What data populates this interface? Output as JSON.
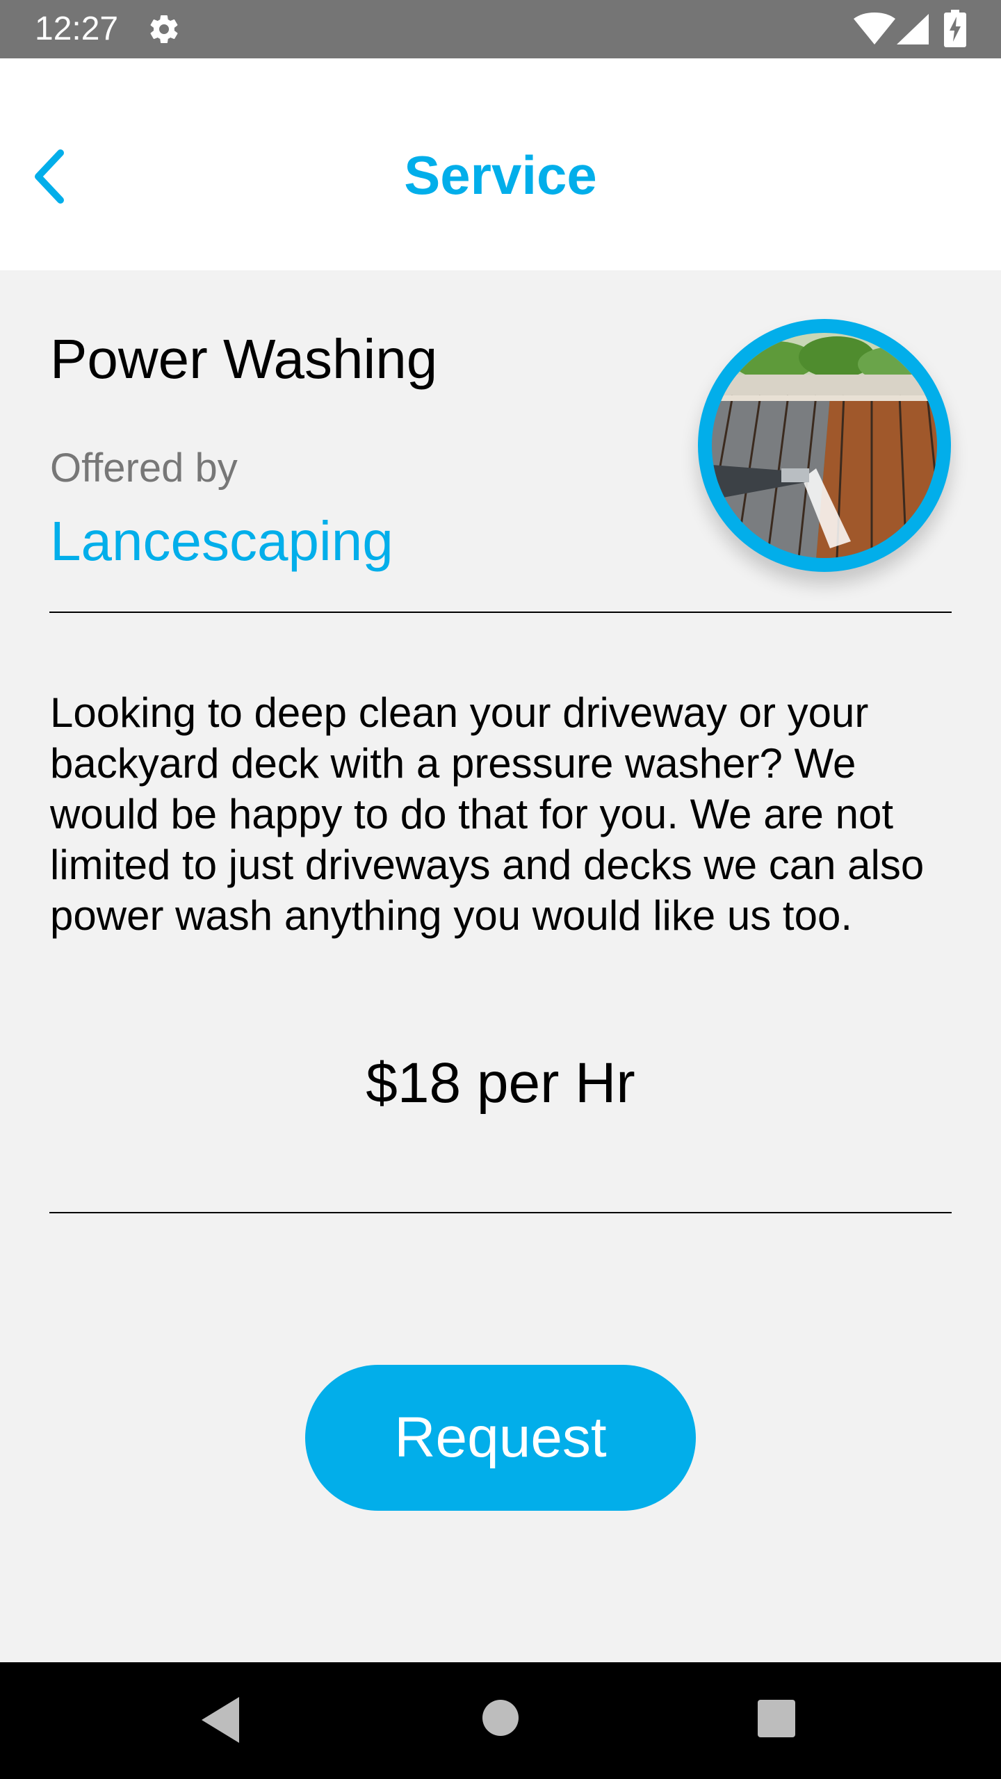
{
  "status_bar": {
    "time": "12:27",
    "icons": [
      "gear-icon",
      "wifi-icon",
      "cell-signal-icon",
      "battery-charging-icon"
    ]
  },
  "app_bar": {
    "title": "Service",
    "back_icon": "chevron-left-icon",
    "accent_color": "#02aeea"
  },
  "service": {
    "name": "Power Washing",
    "offered_label": "Offered by",
    "provider": "Lancescaping",
    "image_icon": "power-washing-deck-photo",
    "description": "Looking to deep clean your driveway or your backyard deck with a pressure washer? We would be happy to do that for you. We are not limited to just driveways and decks we can also power wash anything you would like us too.",
    "price": "$18 per Hr"
  },
  "actions": {
    "request_label": "Request"
  },
  "nav_bar": {
    "icons": [
      "nav-back-icon",
      "nav-home-icon",
      "nav-recents-icon"
    ]
  }
}
